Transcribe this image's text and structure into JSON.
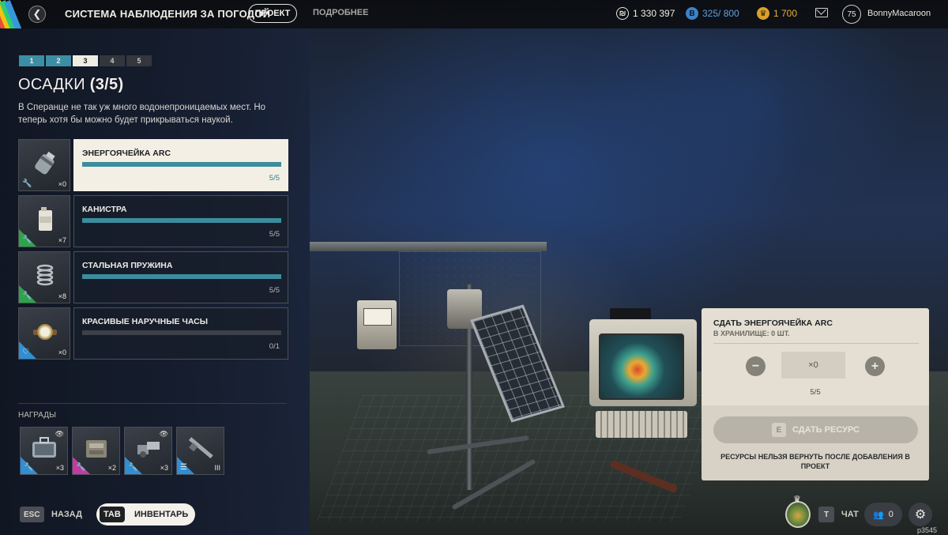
{
  "topbar": {
    "back_icon": "chevron-left-icon",
    "title": "СИСТЕМА НАБЛЮДЕНИЯ ЗА ПОГОДОЙ",
    "tabs": [
      {
        "label": "ПРОЕКТ",
        "active": true
      },
      {
        "label": "ПОДРОБНЕЕ",
        "active": false
      }
    ],
    "currencies": [
      {
        "icon": "coin-icon",
        "value": "1 330 397",
        "color": "#f0eee8"
      },
      {
        "icon": "blue-token-icon",
        "value": "325/ 800",
        "color": "#5ea0e2"
      },
      {
        "icon": "gold-token-icon",
        "value": "1 700",
        "color": "#e7b233"
      }
    ],
    "mail_icon": "mail-icon",
    "level": "75",
    "username": "BonnyMacaroon"
  },
  "steps": [
    {
      "label": "1",
      "state": "done"
    },
    {
      "label": "2",
      "state": "done"
    },
    {
      "label": "3",
      "state": "active"
    },
    {
      "label": "4",
      "state": "todo"
    },
    {
      "label": "5",
      "state": "todo"
    }
  ],
  "section": {
    "title": "ОСАДКИ",
    "progress": "(3/5)",
    "description": "В Сперанце не так уж много водонепроницаемых мест. Но теперь хотя бы можно будет прикрываться наукой."
  },
  "items": [
    {
      "name": "ЭНЕРГОЯЧЕЙКА ARC",
      "owned": "×0",
      "progress_text": "5/5",
      "progress": 1.0,
      "rarity": "none",
      "selected": true,
      "icon": "energy-cell-icon"
    },
    {
      "name": "КАНИСТРА",
      "owned": "×7",
      "progress_text": "5/5",
      "progress": 1.0,
      "rarity": "green",
      "selected": false,
      "icon": "canister-icon"
    },
    {
      "name": "СТАЛЬНАЯ ПРУЖИНА",
      "owned": "×8",
      "progress_text": "5/5",
      "progress": 1.0,
      "rarity": "green",
      "selected": false,
      "icon": "spring-icon"
    },
    {
      "name": "КРАСИВЫЕ НАРУЧНЫЕ ЧАСЫ",
      "owned": "×0",
      "progress_text": "0/1",
      "progress": 0.0,
      "rarity": "blue",
      "selected": false,
      "icon": "wristwatch-icon"
    }
  ],
  "rewards": {
    "label": "НАГРАДЫ",
    "list": [
      {
        "count": "×3",
        "rarity": "blue",
        "eye": true,
        "icon": "toolbox-icon",
        "kind": "wrench-icon"
      },
      {
        "count": "×2",
        "rarity": "pink",
        "eye": false,
        "icon": "crate-icon",
        "kind": "wrench-icon"
      },
      {
        "count": "×3",
        "rarity": "blue",
        "eye": true,
        "icon": "mechanism-icon",
        "kind": "wrench-icon"
      },
      {
        "count": "III",
        "rarity": "blue",
        "eye": false,
        "icon": "rifle-icon",
        "kind": "list-icon"
      }
    ]
  },
  "bottom_left": {
    "esc_key": "ESC",
    "back_label": "НАЗАД",
    "tab_key": "TAB",
    "inventory_label": "ИНВЕНТАРЬ"
  },
  "dialog": {
    "title": "СДАТЬ ЭНЕРГОЯЧЕЙКА ARC",
    "subtitle": "В ХРАНИЛИЩЕ: 0 ШТ.",
    "minus": "−",
    "plus": "+",
    "quantity": "×0",
    "progress": "5/5",
    "submit_key": "E",
    "submit_label": "СДАТЬ РЕСУРС",
    "warning": "РЕСУРСЫ НЕЛЬЗЯ ВЕРНУТЬ ПОСЛЕ ДОБАВЛЕНИЯ В ПРОЕКТ"
  },
  "bottom_right": {
    "chat_key": "T",
    "chat_label": "ЧАТ",
    "friends_count": "0",
    "settings_icon": "gear-icon"
  },
  "watermark": "p3545"
}
